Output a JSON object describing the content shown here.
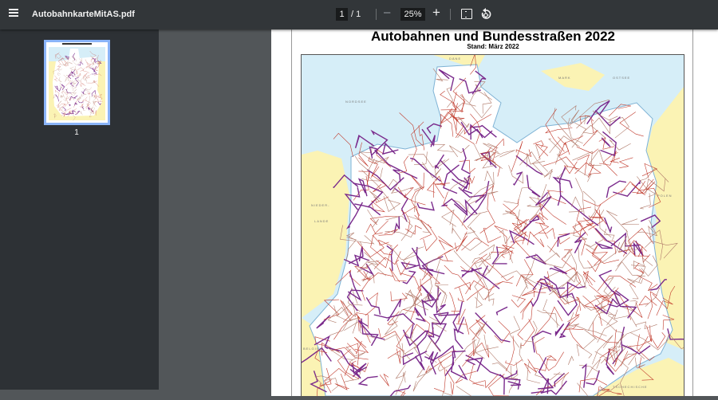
{
  "toolbar": {
    "file_name": "AutobahnkarteMitAS.pdf",
    "current_page": "1",
    "page_total": "/ 1",
    "zoom_level": "25%",
    "zoom_out_label": "–",
    "zoom_in_label": "+"
  },
  "sidebar": {
    "thumbnails": [
      {
        "page_label": "1"
      }
    ]
  },
  "document": {
    "title": "Autobahnen und Bundesstraßen 2022",
    "subtitle": "Stand: März 2022",
    "map_labels": {
      "denmark": "DÄNE",
      "danish_island": "MARK",
      "baltic": "OSTSEE",
      "north_sea": "NORDSEE",
      "netherlands_1": "NIEDER-",
      "netherlands_2": "LANDE",
      "poland": "POLEN",
      "belgium": "BELGIEN",
      "czech": "TSCHECHISCHE"
    }
  },
  "colors": {
    "toolbar": "#323639",
    "sidebar": "#2d3135",
    "viewer_bg": "#525659",
    "sea": "#d6eef8",
    "neighbour": "#fbf3b4",
    "autobahn": "#7a2a8c",
    "bundesstrasse": "#c0392b"
  }
}
